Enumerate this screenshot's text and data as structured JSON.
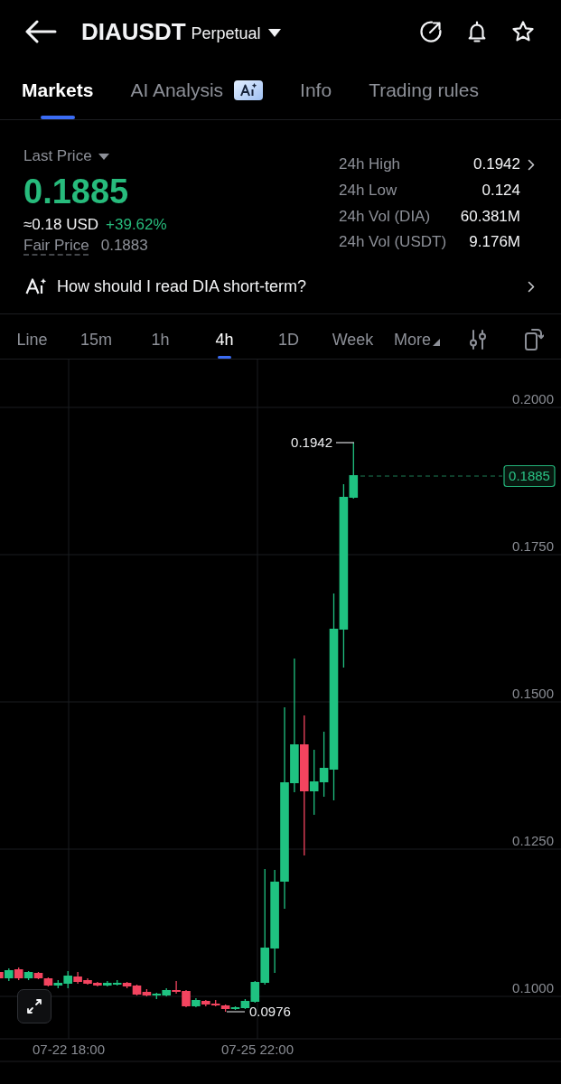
{
  "header": {
    "symbol": "DIAUSDT",
    "contract": "Perpetual"
  },
  "tabs": [
    {
      "label": "Markets",
      "selected": true,
      "badge": false
    },
    {
      "label": "AI Analysis",
      "selected": false,
      "badge": true
    },
    {
      "label": "Info",
      "selected": false,
      "badge": false
    },
    {
      "label": "Trading rules",
      "selected": false,
      "badge": false
    }
  ],
  "price": {
    "label": "Last Price",
    "value": "0.1885",
    "usd": "≈0.18 USD",
    "change": "+39.62%",
    "fair_label": "Fair Price",
    "fair_value": "0.1883"
  },
  "stats": [
    {
      "label": "24h High",
      "value": "0.1942",
      "link": true
    },
    {
      "label": "24h Low",
      "value": "0.124",
      "link": false
    },
    {
      "label": "24h Vol (DIA)",
      "value": "60.381M",
      "link": false
    },
    {
      "label": "24h Vol (USDT)",
      "value": "9.176M",
      "link": false
    }
  ],
  "ai_prompt": {
    "text": "How should I read DIA short-term?"
  },
  "intervals": [
    {
      "label": "Line",
      "selected": false,
      "kind": "option"
    },
    {
      "label": "15m",
      "selected": false,
      "kind": "option"
    },
    {
      "label": "1h",
      "selected": false,
      "kind": "option"
    },
    {
      "label": "4h",
      "selected": true,
      "kind": "option"
    },
    {
      "label": "1D",
      "selected": false,
      "kind": "option"
    },
    {
      "label": "Week",
      "selected": false,
      "kind": "option"
    },
    {
      "label": "More",
      "selected": false,
      "kind": "dropdown"
    }
  ],
  "chart": {
    "y_labels": [
      "0.2000",
      "0.1750",
      "0.1500",
      "0.1250",
      "0.1000"
    ],
    "x_labels": [
      "07-22 18:00",
      "07-25 22:00"
    ],
    "high_label": "0.1942",
    "low_label": "0.0976",
    "last_price": "0.1885"
  }
}
